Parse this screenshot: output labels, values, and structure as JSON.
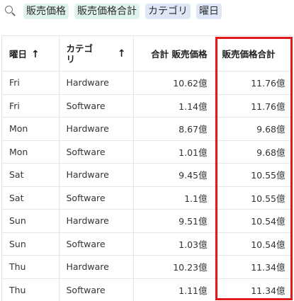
{
  "filters": {
    "chips": [
      {
        "label": "販売価格",
        "style": "green"
      },
      {
        "label": "販売価格合計",
        "style": "green"
      },
      {
        "label": "カテゴリ",
        "style": "blue"
      },
      {
        "label": "曜日",
        "style": "blue"
      }
    ]
  },
  "table": {
    "headers": {
      "day": "曜日",
      "day_sort": "↑",
      "category": "カテゴリ",
      "category_sort": "↑",
      "sum_price": "合計 販売価格",
      "total_price": "販売価格合計"
    },
    "rows": [
      {
        "day": "Fri",
        "category": "Hardware",
        "sum_price": "10.62億",
        "total_price": "11.76億"
      },
      {
        "day": "Fri",
        "category": "Software",
        "sum_price": "1.14億",
        "total_price": "11.76億"
      },
      {
        "day": "Mon",
        "category": "Hardware",
        "sum_price": "8.67億",
        "total_price": "9.68億"
      },
      {
        "day": "Mon",
        "category": "Software",
        "sum_price": "1.01億",
        "total_price": "9.68億"
      },
      {
        "day": "Sat",
        "category": "Hardware",
        "sum_price": "9.45億",
        "total_price": "10.55億"
      },
      {
        "day": "Sat",
        "category": "Software",
        "sum_price": "1.1億",
        "total_price": "10.55億"
      },
      {
        "day": "Sun",
        "category": "Hardware",
        "sum_price": "9.51億",
        "total_price": "10.54億"
      },
      {
        "day": "Sun",
        "category": "Software",
        "sum_price": "1.03億",
        "total_price": "10.54億"
      },
      {
        "day": "Thu",
        "category": "Hardware",
        "sum_price": "10.23億",
        "total_price": "11.34億"
      },
      {
        "day": "Thu",
        "category": "Software",
        "sum_price": "1.11億",
        "total_price": "11.34億"
      }
    ]
  },
  "colors": {
    "chip_green": "#dff3ea",
    "chip_blue": "#dfe7f7",
    "highlight_border": "#e0191b"
  },
  "icons": {
    "search": "search-icon"
  }
}
